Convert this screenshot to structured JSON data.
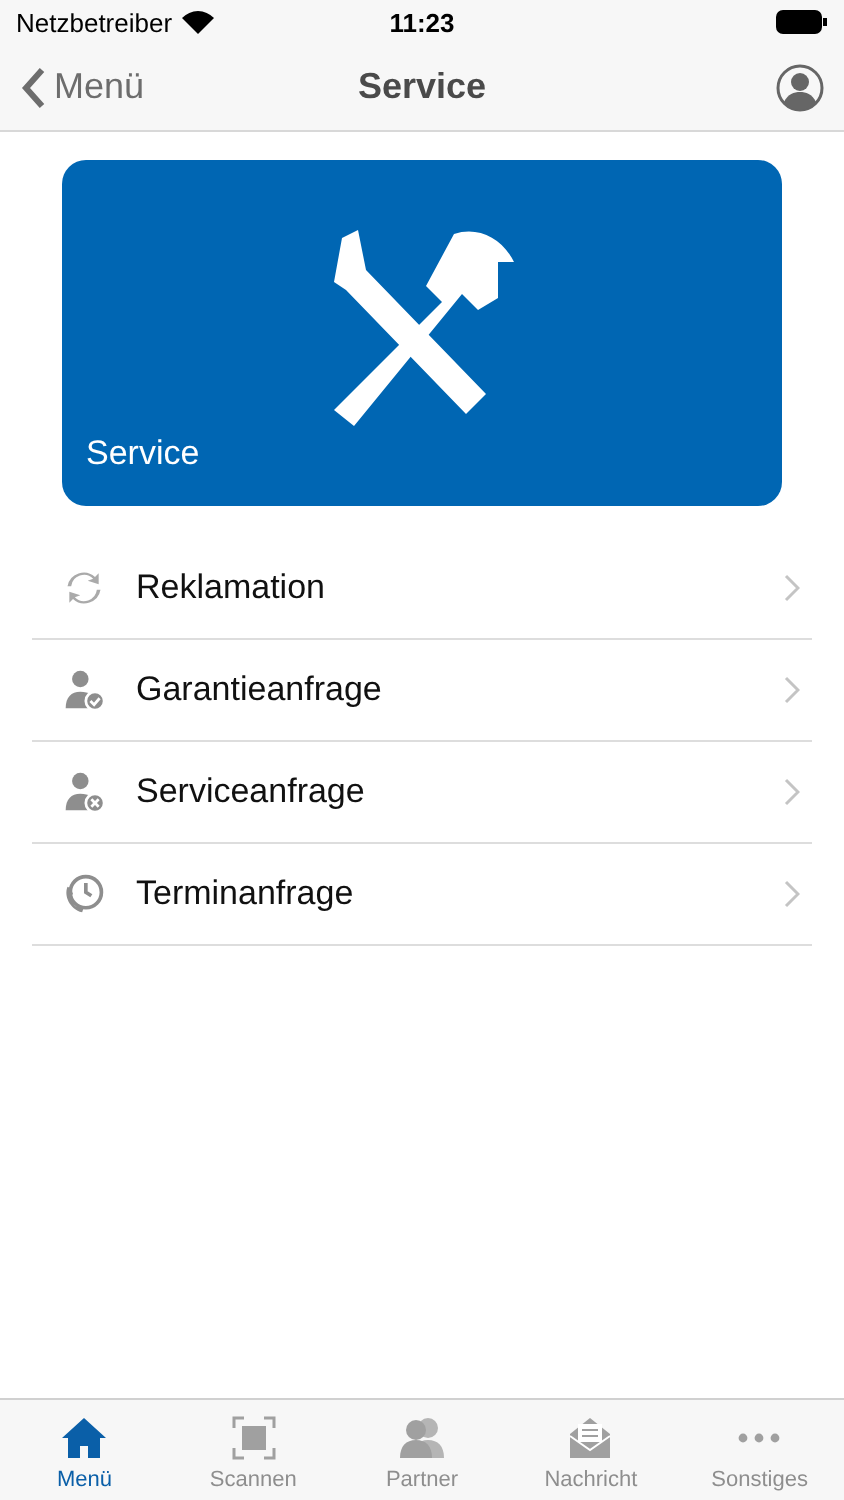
{
  "status_bar": {
    "carrier": "Netzbetreiber",
    "time": "11:23"
  },
  "nav": {
    "back": "Menü",
    "title": "Service"
  },
  "banner": {
    "label": "Service"
  },
  "items": [
    {
      "kind": "refresh",
      "label": "Reklamation"
    },
    {
      "kind": "warranty",
      "label": "Garantieanfrage"
    },
    {
      "kind": "service",
      "label": "Serviceanfrage"
    },
    {
      "kind": "appointment",
      "label": "Terminanfrage"
    }
  ],
  "tabs": [
    {
      "kind": "home",
      "label": "Menü",
      "selected": true
    },
    {
      "kind": "scan",
      "label": "Scannen",
      "selected": false
    },
    {
      "kind": "partner",
      "label": "Partner",
      "selected": false
    },
    {
      "kind": "message",
      "label": "Nachricht",
      "selected": false
    },
    {
      "kind": "more",
      "label": "Sonstiges",
      "selected": false
    }
  ]
}
